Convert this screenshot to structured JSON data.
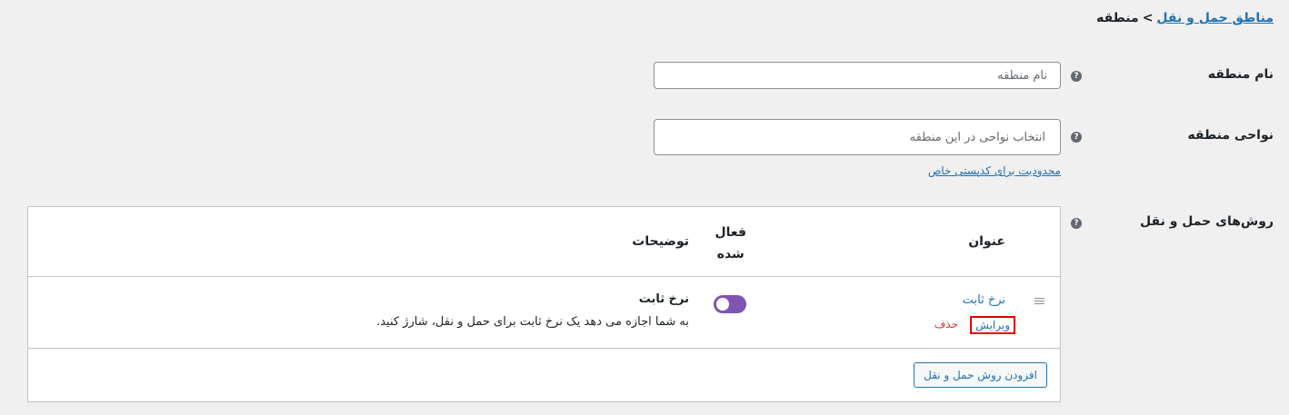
{
  "breadcrumb": {
    "parent": "مناطق حمل و نقل",
    "separator": ">",
    "current": "منطقه"
  },
  "zone_name": {
    "label": "نام منطقه",
    "placeholder": "نام منطقه",
    "help": "?"
  },
  "zone_regions": {
    "label": "نواحی منطقه",
    "placeholder": "انتخاب نواحی در این منطقه",
    "help": "?",
    "limit_link": "محدودیت برای کدپستی خاص"
  },
  "methods": {
    "label": "روش‌های حمل و نقل",
    "help": "?",
    "headers": {
      "title": "عنوان",
      "enabled_line1": "فعال",
      "enabled_line2": "شده",
      "description": "توضیحات"
    },
    "rows": [
      {
        "title": "نرخ ثابت",
        "edit": "ویرایش",
        "delete": "حذف",
        "enabled": true,
        "desc_title": "نرخ ثابت",
        "desc_text": "به شما اجازه می دهد یک نرخ ثابت برای حمل و نقل، شارژ کنید."
      }
    ],
    "add_button": "افزودن روش حمل و نقل"
  },
  "colors": {
    "accent": "#2271b1",
    "toggle": "#7f54b3",
    "danger": "#d63638",
    "highlight": "#e00000"
  }
}
